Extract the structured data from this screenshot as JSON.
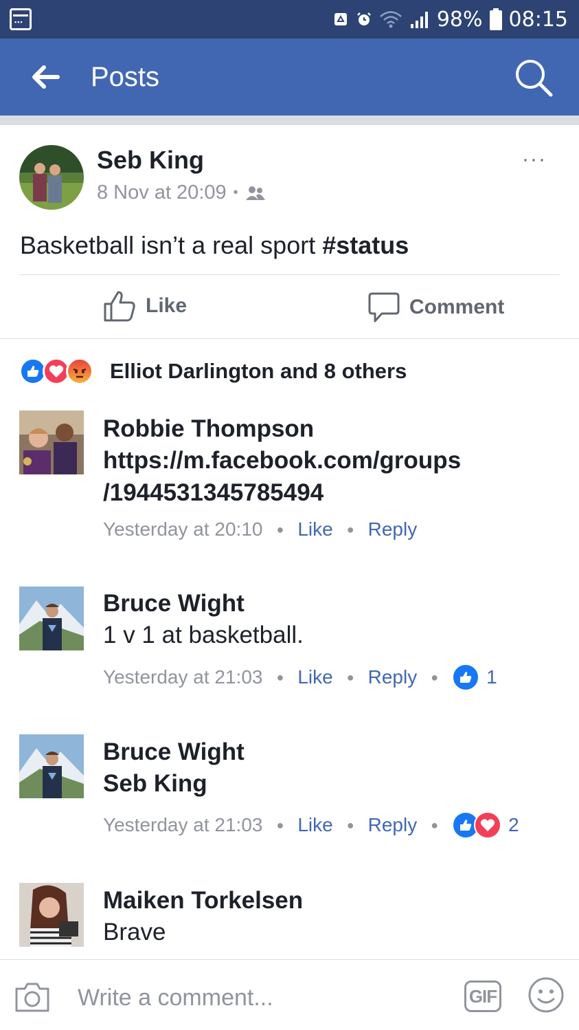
{
  "status_bar": {
    "battery": "98%",
    "time": "08:15",
    "icons": [
      "calendar-icon",
      "recycle-icon",
      "alarm-icon",
      "wifi-icon",
      "signal-icon",
      "battery-icon"
    ]
  },
  "app_bar": {
    "title": "Posts",
    "back_icon": "arrow-left-icon",
    "search_icon": "search-icon",
    "color": "#4267b2"
  },
  "post": {
    "author": "Seb King",
    "timestamp": "8 Nov at 20:09",
    "separator": "•",
    "audience_icon": "friends-icon",
    "more": "···",
    "text": "Basketball isn’t a real sport ",
    "hashtag": "#status",
    "actions": {
      "like": "Like",
      "comment": "Comment"
    },
    "reactions_summary": "Elliot Darlington and 8 others",
    "reaction_icons": [
      "like-reaction-icon",
      "love-reaction-icon",
      "angry-reaction-icon"
    ]
  },
  "comments": [
    {
      "author": "Robbie Thompson",
      "text_line1": "https://m.facebook.com/groups",
      "text_line2": "/1944531345785494",
      "time": "Yesterday at 20:10",
      "like": "Like",
      "reply": "Reply"
    },
    {
      "author": "Bruce Wight",
      "text": "1 v 1 at basketball.",
      "time": "Yesterday at 21:03",
      "like": "Like",
      "reply": "Reply",
      "reaction_count": "1"
    },
    {
      "author": "Bruce Wight",
      "text": "Seb King",
      "time": "Yesterday at 21:03",
      "like": "Like",
      "reply": "Reply",
      "reaction_count": "2"
    },
    {
      "author": "Maiken Torkelsen",
      "text": "Brave"
    }
  ],
  "composer": {
    "placeholder": "Write a comment...",
    "gif_label": "GIF",
    "camera_icon": "camera-icon",
    "emoji_icon": "emoji-icon"
  },
  "colors": {
    "status_bar": "#2d4373",
    "app_bar": "#4267b2",
    "link": "#4267b2",
    "like_blue": "#1877f2",
    "love_red": "#f33e58",
    "angry_orange": "#f7714c"
  }
}
